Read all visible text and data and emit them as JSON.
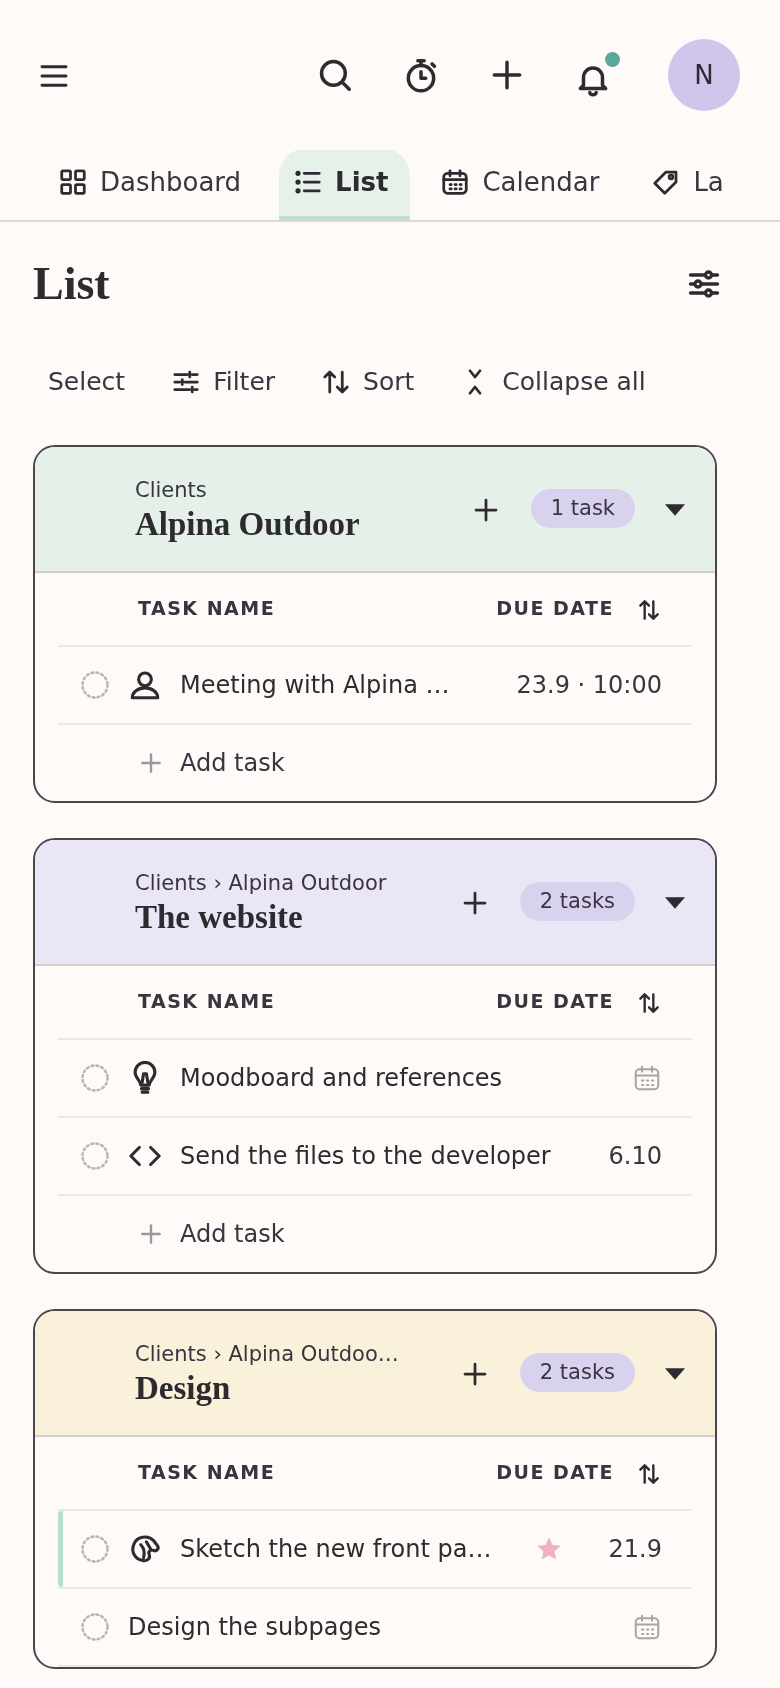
{
  "header": {
    "avatar": "N",
    "notifications_unread": true
  },
  "tabs": [
    {
      "label": "Dashboard",
      "kind": "grid",
      "selected": false
    },
    {
      "label": "List",
      "kind": "list",
      "selected": true
    },
    {
      "label": "Calendar",
      "kind": "calendar",
      "selected": false
    },
    {
      "label": "La",
      "kind": "tag",
      "selected": false
    }
  ],
  "page_title": "List",
  "toolbar": [
    {
      "label": "Select",
      "kind": "plain"
    },
    {
      "label": "Filter",
      "kind": "sliders"
    },
    {
      "label": "Sort",
      "kind": "sort"
    },
    {
      "label": "Collapse all",
      "kind": "collapse"
    }
  ],
  "groups": [
    {
      "breadcrumb": "Clients",
      "title": "Alpina Outdoor",
      "count": "1 task",
      "color": "#e5f0e8",
      "columns": [
        "TASK NAME",
        "DUE DATE"
      ],
      "add_label": "Add task",
      "tasks": [
        {
          "kind": "person",
          "name": "Meeting with Alpina …",
          "due": "23.9 · 10:00",
          "checked": false,
          "starred": false,
          "active": false
        }
      ]
    },
    {
      "breadcrumb": "Clients › Alpina Outdoor",
      "title": "The website",
      "count": "2 tasks",
      "color": "#ebe6f5",
      "columns": [
        "TASK NAME",
        "DUE DATE"
      ],
      "add_label": "Add task",
      "tasks": [
        {
          "kind": "bulb",
          "name": "Moodboard and references",
          "checked": false,
          "starred": false,
          "active": false
        },
        {
          "kind": "code",
          "name": "Send the files to the developer",
          "due": "6.10",
          "checked": false,
          "starred": false,
          "active": false
        }
      ]
    },
    {
      "breadcrumb": "Clients › Alpina Outdoo…",
      "title": "Design",
      "count": "2 tasks",
      "color": "#f9f1da",
      "columns": [
        "TASK NAME",
        "DUE DATE"
      ],
      "tasks": [
        {
          "kind": "palette",
          "name": "Sketch the new front pa…",
          "due": "21.9",
          "checked": false,
          "starred": true,
          "active": true
        },
        {
          "kind": "plain",
          "name": "Design the subpages",
          "checked": false,
          "starred": false,
          "active": false
        }
      ]
    }
  ]
}
